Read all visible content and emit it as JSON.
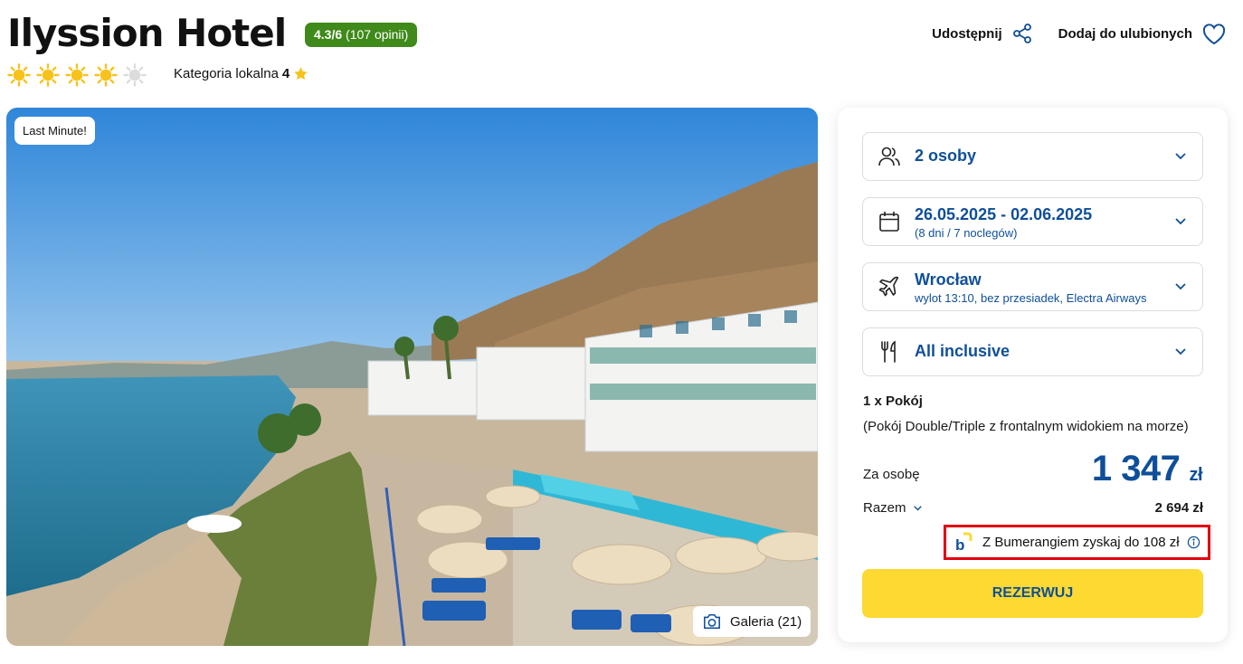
{
  "hotel": {
    "name": "Ilyssion Hotel",
    "rating_score": "4.3/6",
    "rating_reviews": "(107 opinii)",
    "suns_filled": 4,
    "suns_total": 5,
    "local_category_label": "Kategoria lokalna",
    "local_category_value": "4"
  },
  "actions": {
    "share_label": "Udostępnij",
    "favorite_label": "Dodaj do ulubionych"
  },
  "photo": {
    "badge": "Last Minute!",
    "gallery_label": "Galeria (21)"
  },
  "booking": {
    "guests": "2 osoby",
    "dates": "26.05.2025 - 02.06.2025",
    "dates_sub": "(8 dni / 7 noclegów)",
    "departure_city": "Wrocław",
    "departure_sub": "wylot 13:10, bez przesiadek, Electra Airways",
    "board": "All inclusive",
    "room_qty": "1 x Pokój",
    "room_desc": "(Pokój Double/Triple z frontalnym widokiem na morze)",
    "per_person_label": "Za osobę",
    "price_value": "1 347",
    "price_currency": "zł",
    "total_label": "Razem",
    "total_value": "2 694 zł",
    "bumerang_text": "Z Bumerangiem zyskaj do 108 zł",
    "book_button": "REZERWUJ"
  },
  "colors": {
    "brand_blue": "#0f4f9a",
    "rating_green": "#3f8a1a",
    "book_yellow": "#fdd931",
    "highlight_red": "#e3000f",
    "sun_yellow": "#f7c21b"
  }
}
